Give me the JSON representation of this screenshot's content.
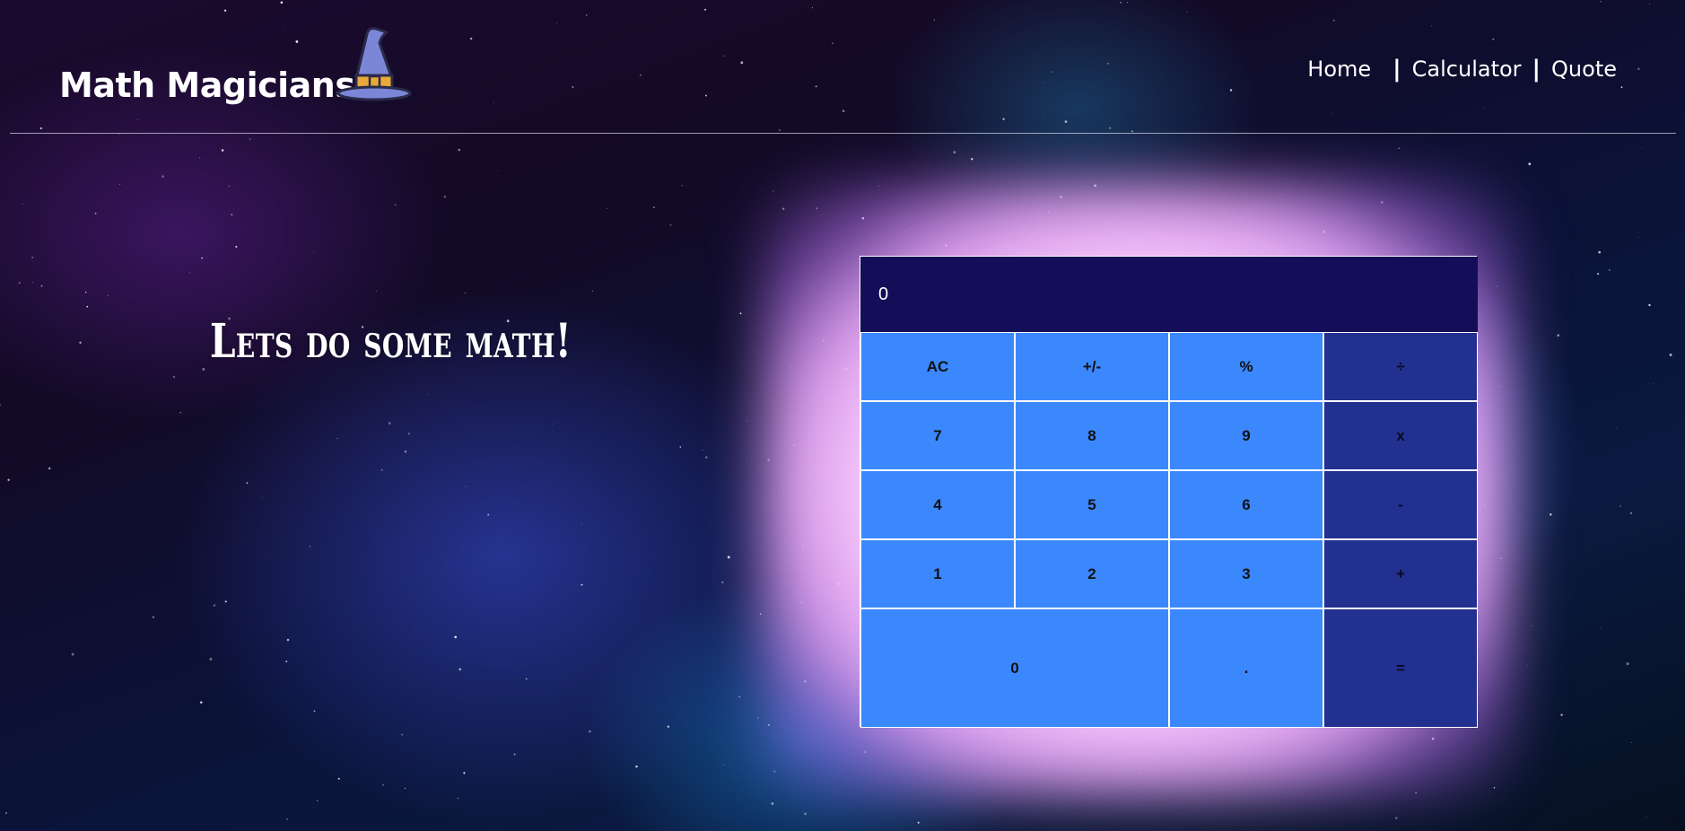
{
  "header": {
    "logo_text": "Math Magicians",
    "nav": [
      {
        "label": "Home"
      },
      {
        "label": "Calculator"
      },
      {
        "label": "Quote"
      }
    ],
    "separator": "|"
  },
  "main": {
    "headline": "Lets do some math!"
  },
  "calculator": {
    "display_value": "0",
    "keys": {
      "ac": "AC",
      "sign": "+/-",
      "percent": "%",
      "divide": "÷",
      "seven": "7",
      "eight": "8",
      "nine": "9",
      "multiply": "x",
      "four": "4",
      "five": "5",
      "six": "6",
      "subtract": "-",
      "one": "1",
      "two": "2",
      "three": "3",
      "add": "+",
      "zero": "0",
      "decimal": ".",
      "equals": "="
    }
  },
  "colors": {
    "display_bg": "#140e58",
    "key_bg": "#3b88fd",
    "operator_bg": "#22308f",
    "glow": "#f0b0ff"
  },
  "icons": {
    "logo_icon": "wizard-hat-icon"
  }
}
